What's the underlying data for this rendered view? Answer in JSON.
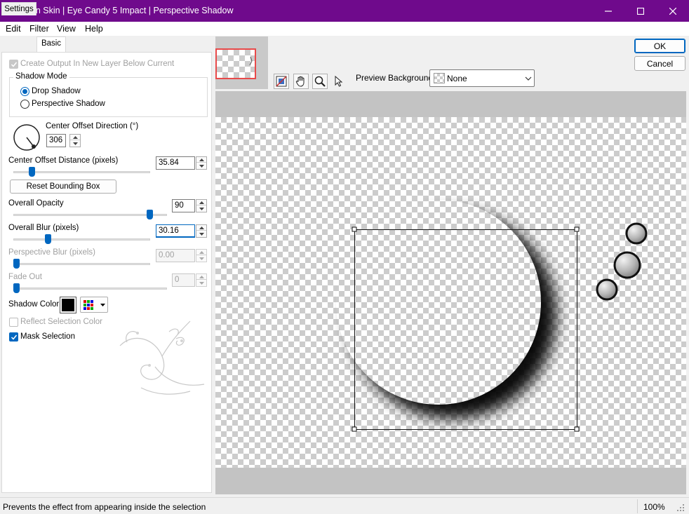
{
  "window": {
    "title": "Alien Skin | Eye Candy 5 Impact | Perspective Shadow"
  },
  "menu": [
    "Edit",
    "Filter",
    "View",
    "Help"
  ],
  "tabs": {
    "settings": "Settings",
    "basic": "Basic"
  },
  "basic": {
    "create_output": {
      "label": "Create Output In New Layer Below Current",
      "checked": true,
      "enabled": false
    },
    "shadow_mode": {
      "title": "Shadow Mode",
      "options": [
        "Drop Shadow",
        "Perspective Shadow"
      ],
      "selected": "Drop Shadow"
    },
    "center_offset_direction": {
      "label": "Center Offset Direction (°)",
      "value": "306"
    },
    "center_offset_distance": {
      "label": "Center Offset Distance (pixels)",
      "value": "35.84",
      "slider": 0.12
    },
    "reset_bounding_box": "Reset Bounding Box",
    "overall_opacity": {
      "label": "Overall Opacity",
      "value": "90",
      "slider": 0.9
    },
    "overall_blur": {
      "label": "Overall Blur (pixels)",
      "value": "30.16",
      "slider": 0.24
    },
    "perspective_blur": {
      "label": "Perspective Blur (pixels)",
      "value": "0.00",
      "slider": 0.0,
      "enabled": false
    },
    "fade_out": {
      "label": "Fade Out",
      "value": "0",
      "slider": 0.0,
      "enabled": false
    },
    "shadow_color": {
      "label": "Shadow Color",
      "color": "#000000"
    },
    "reflect_selection_color": {
      "label": "Reflect Selection Color",
      "checked": false,
      "enabled": false
    },
    "mask_selection": {
      "label": "Mask Selection",
      "checked": true
    }
  },
  "preview": {
    "background_label": "Preview Background:",
    "background_value": "None",
    "tools": [
      "preview-toggle-icon",
      "hand-icon",
      "zoom-icon",
      "arrow-icon"
    ]
  },
  "buttons": {
    "ok": "OK",
    "cancel": "Cancel"
  },
  "status": {
    "message": "Prevents the effect from appearing inside the selection",
    "zoom": "100%"
  },
  "colors": {
    "title_bar": "#6f0a8c",
    "accent": "#0067c0"
  }
}
